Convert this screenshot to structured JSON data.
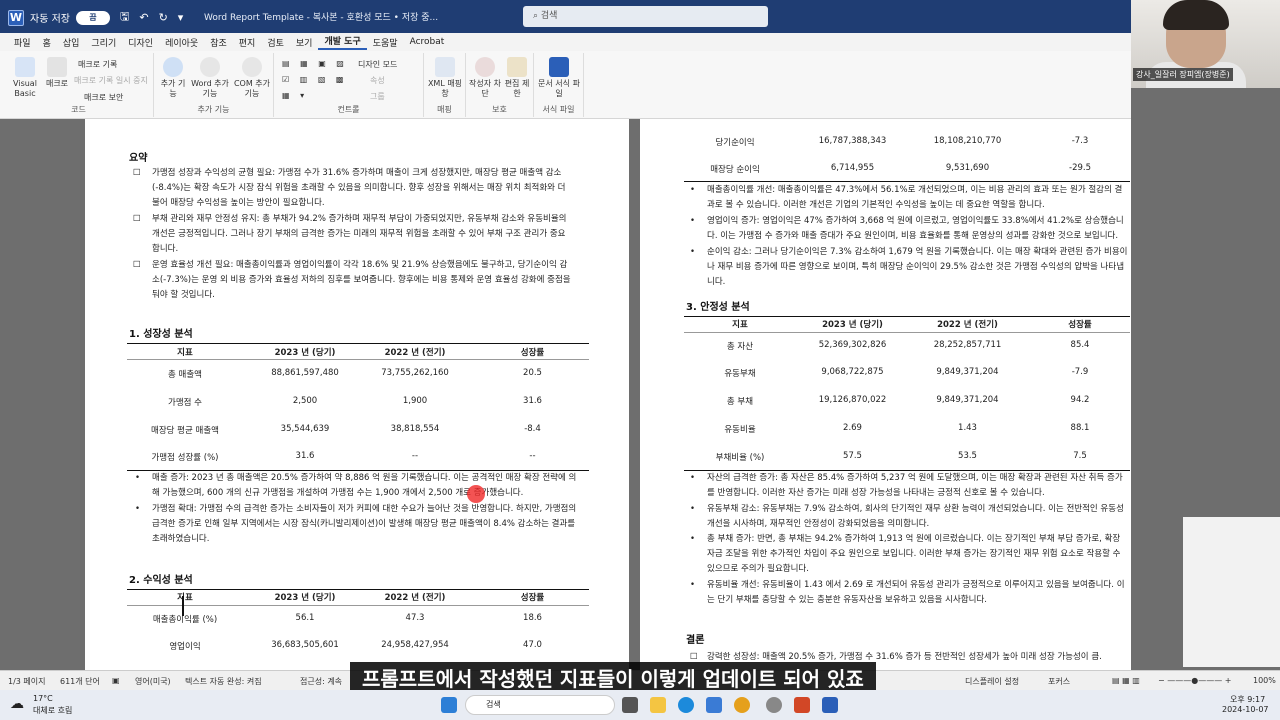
{
  "titlebar": {
    "autosave": "자동 저장",
    "toggle": "끔",
    "title": "Word Report Template - 복사본 - 호환성 모드 • 저장 중...",
    "search": "검색"
  },
  "menu": [
    "파일",
    "홈",
    "삽입",
    "그리기",
    "디자인",
    "레이아웃",
    "참조",
    "편지",
    "검토",
    "보기",
    "개발 도구",
    "도움말",
    "Acrobat"
  ],
  "ribbon": {
    "vb": "Visual Basic",
    "macro": "매크로",
    "record": "매크로 기록",
    "pause": "매크로 기록 일시 중지",
    "security": "매크로 보안",
    "code": "코드",
    "addin": "추가 기능",
    "word_addin": "Word 추가 기능",
    "com_addin": "COM 추가 기능",
    "addin_group": "추가 기능",
    "design_mode": "디자인 모드",
    "props": "속성",
    "group": "그룹",
    "controls": "컨트롤",
    "xml": "XML 매핑 창",
    "mapping": "매핑",
    "block": "작성자 차단",
    "restrict": "편집 제한",
    "protect": "보호",
    "template": "문서 서식 파일",
    "tpl_group": "서식 파일"
  },
  "camera": {
    "label": "강사_일잘러 장피엠(장병준)"
  },
  "left": {
    "summary_h": "요약",
    "s1": "가맹점 성장과 수익성의 균형 필요: 가맹점 수가 31.6% 증가하며 매출이 크게 성장했지만, 매장당 평균 매출액 감소(-8.4%)는 확장 속도가 시장 잠식 위험을 초래할 수 있음을 의미합니다. 향후 성장을 위해서는 매장 위치 최적화와 더불어 매장당 수익성을 높이는 방안이 필요합니다.",
    "s2": "부채 관리와 재무 안정성 유지: 총 부채가 94.2% 증가하며 재무적 부담이 가중되었지만, 유동부채 감소와 유동비율의 개선은 긍정적입니다. 그러나 장기 부채의 급격한 증가는 미래의 재무적 위험을 초래할 수 있어 부채 구조 관리가 중요합니다.",
    "s3": "운영 효율성 개선 필요: 매출총이익률과 영업이익률이 각각 18.6% 및 21.9% 상승했음에도 불구하고, 당기순이익 감소(-7.3%)는 운영 외 비용 증가와 효율성 저하의 징후를 보여줍니다. 향후에는 비용 통제와 운영 효율성 강화에 중점을 둬야 할 것입니다.",
    "g_h": "1. 성장성 분석",
    "cols": [
      "지표",
      "2023 년 (당기)",
      "2022 년 (전기)",
      "성장률"
    ],
    "g_rows": [
      [
        "총 매출액",
        "88,861,597,480",
        "73,755,262,160",
        "20.5"
      ],
      [
        "가맹점 수",
        "2,500",
        "1,900",
        "31.6"
      ],
      [
        "매장당 평균 매출액",
        "35,544,639",
        "38,818,554",
        "-8.4"
      ],
      [
        "가맹점 성장률 (%)",
        "31.6",
        "--",
        "--"
      ]
    ],
    "g_b1": "매출 증가: 2023 년 총 매출액은 20.5% 증가하여 약 8,886 억 원을 기록했습니다. 이는 공격적인 매장 확장 전략에 의해 가능했으며, 600 개의 신규 가맹점을 개설하여 가맹점 수는 1,900 개에서 2,500 개로 증가했습니다.",
    "g_b2": "가맹점 확대: 가맹점 수의 급격한 증가는 소비자들이 저가 커피에 대한 수요가 늘어난 것을 반영합니다. 하지만, 가맹점의 급격한 증가로 인해 일부 지역에서는 시장 잠식(카니발리제이션)이 발생해 매장당 평균 매출액이 8.4% 감소하는 결과를 초래하였습니다.",
    "p_h": "2. 수익성 분석",
    "p_rows": [
      [
        "매출총이익률 (%)",
        "56.1",
        "47.3",
        "18.6"
      ],
      [
        "영업이익",
        "36,683,505,601",
        "24,958,427,954",
        "47.0"
      ]
    ]
  },
  "right": {
    "top_rows": [
      [
        "당기순이익",
        "16,787,388,343",
        "18,108,210,770",
        "-7.3"
      ],
      [
        "매장당 순이익",
        "6,714,955",
        "9,531,690",
        "-29.5"
      ]
    ],
    "b1": "매출총이익률 개선: 매출총이익률은 47.3%에서 56.1%로 개선되었으며, 이는 비용 관리의 효과 또는 원가 절감의 결과로 볼 수 있습니다. 이러한 개선은 기업의 기본적인 수익성을 높이는 데 중요한 역할을 합니다.",
    "b2": "영업이익 증가: 영업이익은 47% 증가하여 3,668 억 원에 이르렀고, 영업이익률도 33.8%에서 41.2%로 상승했습니다. 이는 가맹점 수 증가와 매출 증대가 주요 원인이며, 비용 효율화를 통해 운영상의 성과를 강화한 것으로 보입니다.",
    "b3": "순이익 감소: 그러나 당기순이익은 7.3% 감소하여 1,679 억 원을 기록했습니다. 이는 매장 확대와 관련된 증가 비용이나 재무 비용 증가에 따른 영향으로 보이며, 특히 매장당 순이익이 29.5% 감소한 것은 가맹점 수익성의 압박을 나타냅니다.",
    "st_h": "3. 안정성 분석",
    "cols": [
      "지표",
      "2023 년 (당기)",
      "2022 년 (전기)",
      "성장률"
    ],
    "st_rows": [
      [
        "총 자산",
        "52,369,302,826",
        "28,252,857,711",
        "85.4"
      ],
      [
        "유동부채",
        "9,068,722,875",
        "9,849,371,204",
        "-7.9"
      ],
      [
        "총 부채",
        "19,126,870,022",
        "9,849,371,204",
        "94.2"
      ],
      [
        "유동비율",
        "2.69",
        "1.43",
        "88.1"
      ],
      [
        "부채비율 (%)",
        "57.5",
        "53.5",
        "7.5"
      ]
    ],
    "sb1": "자산의 급격한 증가: 총 자산은 85.4% 증가하여 5,237 억 원에 도달했으며, 이는 매장 확장과 관련된 자산 취득 증가를 반영합니다. 이러한 자산 증가는 미래 성장 가능성을 나타내는 긍정적 신호로 볼 수 있습니다.",
    "sb2": "유동부채 감소: 유동부채는 7.9% 감소하여, 회사의 단기적인 재무 상환 능력이 개선되었습니다. 이는 전반적인 유동성 개선을 시사하며, 재무적인 안정성이 강화되었음을 의미합니다.",
    "sb3": "총 부채 증가: 반면, 총 부채는 94.2% 증가하여 1,913 억 원에 이르렀습니다. 이는 장기적인 부채 부담 증가로, 확장 자금 조달을 위한 추가적인 차입이 주요 원인으로 보입니다. 이러한 부채 증가는 장기적인 재무 위험 요소로 작용할 수 있으므로 주의가 필요합니다.",
    "sb4": "유동비율 개선: 유동비율이 1.43 에서 2.69 로 개선되어 유동성 관리가 긍정적으로 이루어지고 있음을 보여줍니다. 이는 단기 부채를 충당할 수 있는 충분한 유동자산을 보유하고 있음을 시사합니다.",
    "c_h": "결론",
    "c1": "강력한 성장성: 매출액 20.5% 증가, 가맹점 수 31.6% 증가 등 전반적인 성장세가 높아 미래 성장 가능성이 큼."
  },
  "subtitle": "프롬프트에서 작성했던 지표들이 이렇게 업데이트 되어 있죠",
  "status": {
    "page": "1/3 페이지",
    "words": "611개 단어",
    "lang": "영어(미국)",
    "predict": "텍스트 자동 완성: 켜짐",
    "access": "접근성: 계속",
    "display": "디스플레이 설정",
    "focus": "포커스",
    "zoom": "100%"
  },
  "taskbar": {
    "temp": "17°C",
    "weather": "대체로 흐림",
    "search": "검색",
    "time": "오후 9:17",
    "date": "2024-10-07"
  }
}
